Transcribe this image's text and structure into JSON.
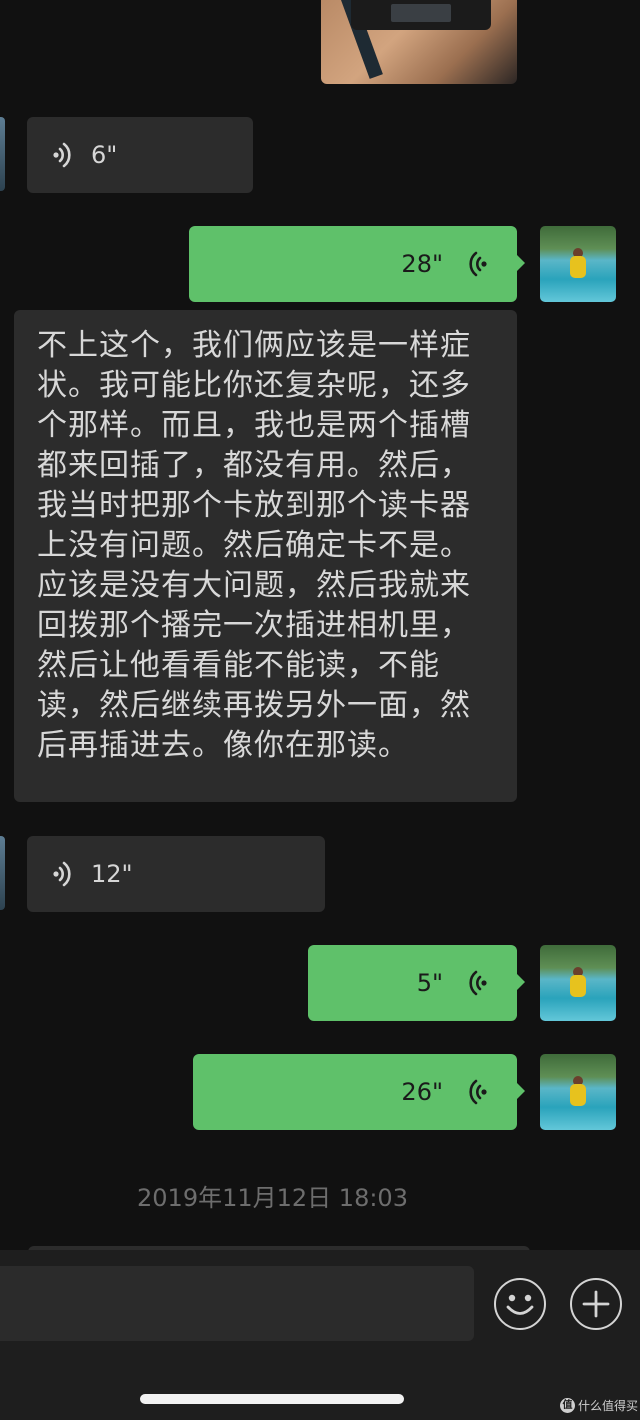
{
  "messages": {
    "voice_in_1": {
      "duration": "6\""
    },
    "voice_out_1": {
      "duration": "28\""
    },
    "text_in_1": {
      "lines": [
        "不上这个，我们俩应该是一样症",
        "状。我可能比你还复杂呢，还多",
        "个那样。而且，我也是两个插槽",
        "都来回插了，都没有用。然后，",
        "我当时把那个卡放到那个读卡器",
        "上没有问题。然后确定卡不是。",
        "应该是没有大问题，然后我就来",
        "回拨那个播完一次插进相机里，",
        "然后让他看看能不能读，不能",
        "读，然后继续再拨另外一面，然",
        "后再插进去。像你在那读。"
      ]
    },
    "voice_in_2": {
      "duration": "12\""
    },
    "voice_out_2": {
      "duration": "5\""
    },
    "voice_out_3": {
      "duration": "26\""
    }
  },
  "timestamp": "2019年11月12日 18:03",
  "input_bar": {
    "emoji_icon": "smiley-face-icon",
    "plus_icon": "plus-circle-icon"
  },
  "watermark": {
    "badge": "值",
    "text": "什么值得买"
  },
  "colors": {
    "background": "#111111",
    "incoming_bubble": "#2c2c2c",
    "outgoing_bubble": "#5fc16a",
    "input_bar": "#1e1e1e"
  }
}
